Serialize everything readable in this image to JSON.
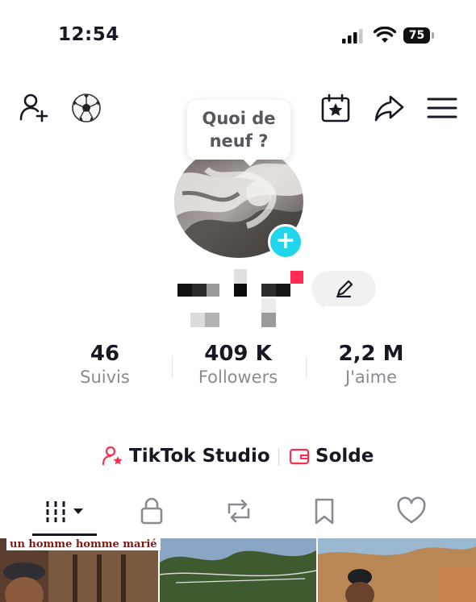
{
  "status_bar": {
    "time": "12:54",
    "battery": "75"
  },
  "bubble": {
    "line1": "Quoi de",
    "line2": "neuf ?"
  },
  "stats": [
    {
      "value": "46",
      "label": "Suivis"
    },
    {
      "value": "409 K",
      "label": "Followers"
    },
    {
      "value": "2,2 M",
      "label": "J'aime"
    }
  ],
  "tools": {
    "studio": "TikTok Studio",
    "solde": "Solde"
  },
  "thumbnails": [
    {
      "caption": "un homme homme marié"
    }
  ],
  "colors": {
    "accent_red": "#fe2c55",
    "story_plus": "#20d5ec",
    "muted": "#8a8b91"
  }
}
